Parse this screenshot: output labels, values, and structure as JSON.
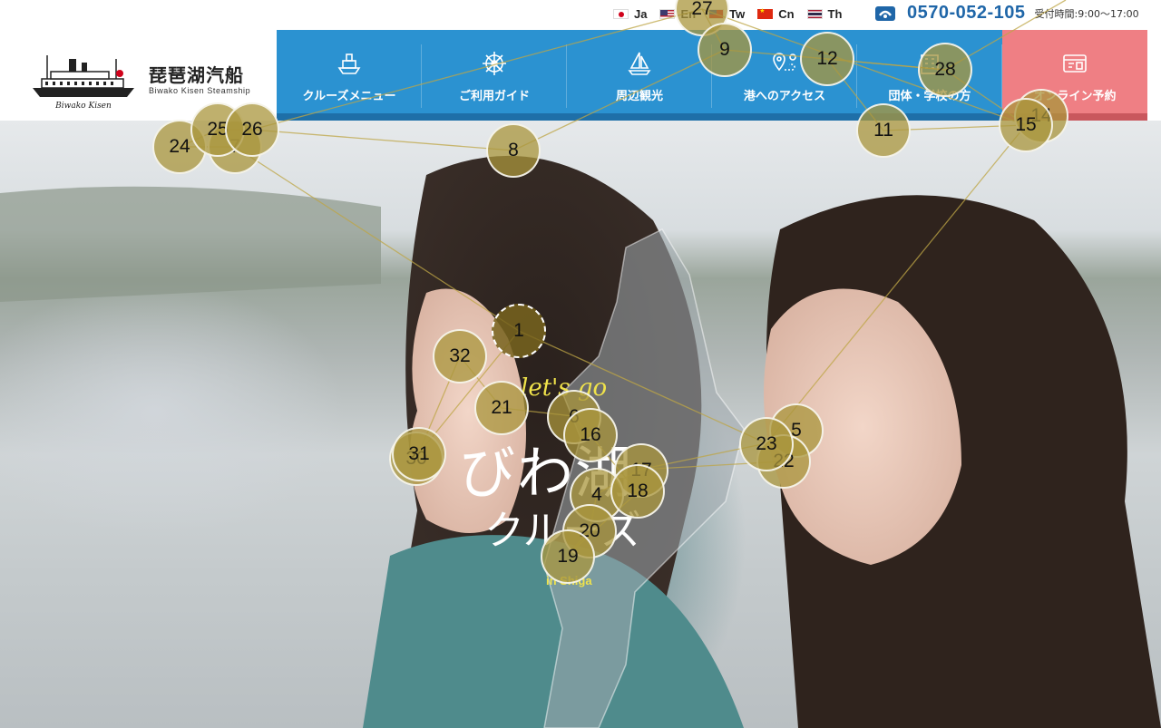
{
  "topbar": {
    "languages": [
      {
        "label": "Ja",
        "flag": "japan-flag-icon"
      },
      {
        "label": "En",
        "flag": "usa-flag-icon"
      },
      {
        "label": "Tw",
        "flag": "taiwan-flag-icon"
      },
      {
        "label": "Cn",
        "flag": "china-flag-icon"
      },
      {
        "label": "Th",
        "flag": "thailand-flag-icon"
      }
    ],
    "phone_number": "0570-052-105",
    "hours": "受付時間:9:00〜17:00"
  },
  "logo": {
    "title": "琵琶湖汽船",
    "subtitle": "Biwako Kisen Steamship",
    "script": "Biwako Kisen"
  },
  "nav": {
    "items": [
      {
        "label": "クルーズメニュー",
        "icon": "ship-icon"
      },
      {
        "label": "ご利用ガイド",
        "icon": "helm-icon"
      },
      {
        "label": "周辺観光",
        "icon": "sailboat-icon"
      },
      {
        "label": "港へのアクセス",
        "icon": "map-pin-icon"
      },
      {
        "label": "団体・学校の方",
        "icon": "building-icon"
      },
      {
        "label": "オンライン予約",
        "icon": "online-reservation-icon"
      }
    ]
  },
  "hero": {
    "tagline": "let's go",
    "title_line1": "びわ湖",
    "title_line2": "クルーズ",
    "caption": "in Shiga"
  },
  "markers": [
    "1",
    "4",
    "5",
    "6",
    "7",
    "8",
    "9",
    "11",
    "12",
    "14",
    "15",
    "16",
    "17",
    "18",
    "19",
    "20",
    "21",
    "22",
    "23",
    "24",
    "25",
    "26",
    "27",
    "28",
    "30",
    "31",
    "32"
  ],
  "colors": {
    "nav_blue": "#2b92d1",
    "nav_reserve": "#ef7f84",
    "phone_blue": "#1f66a8",
    "marker": "#aa963c"
  }
}
